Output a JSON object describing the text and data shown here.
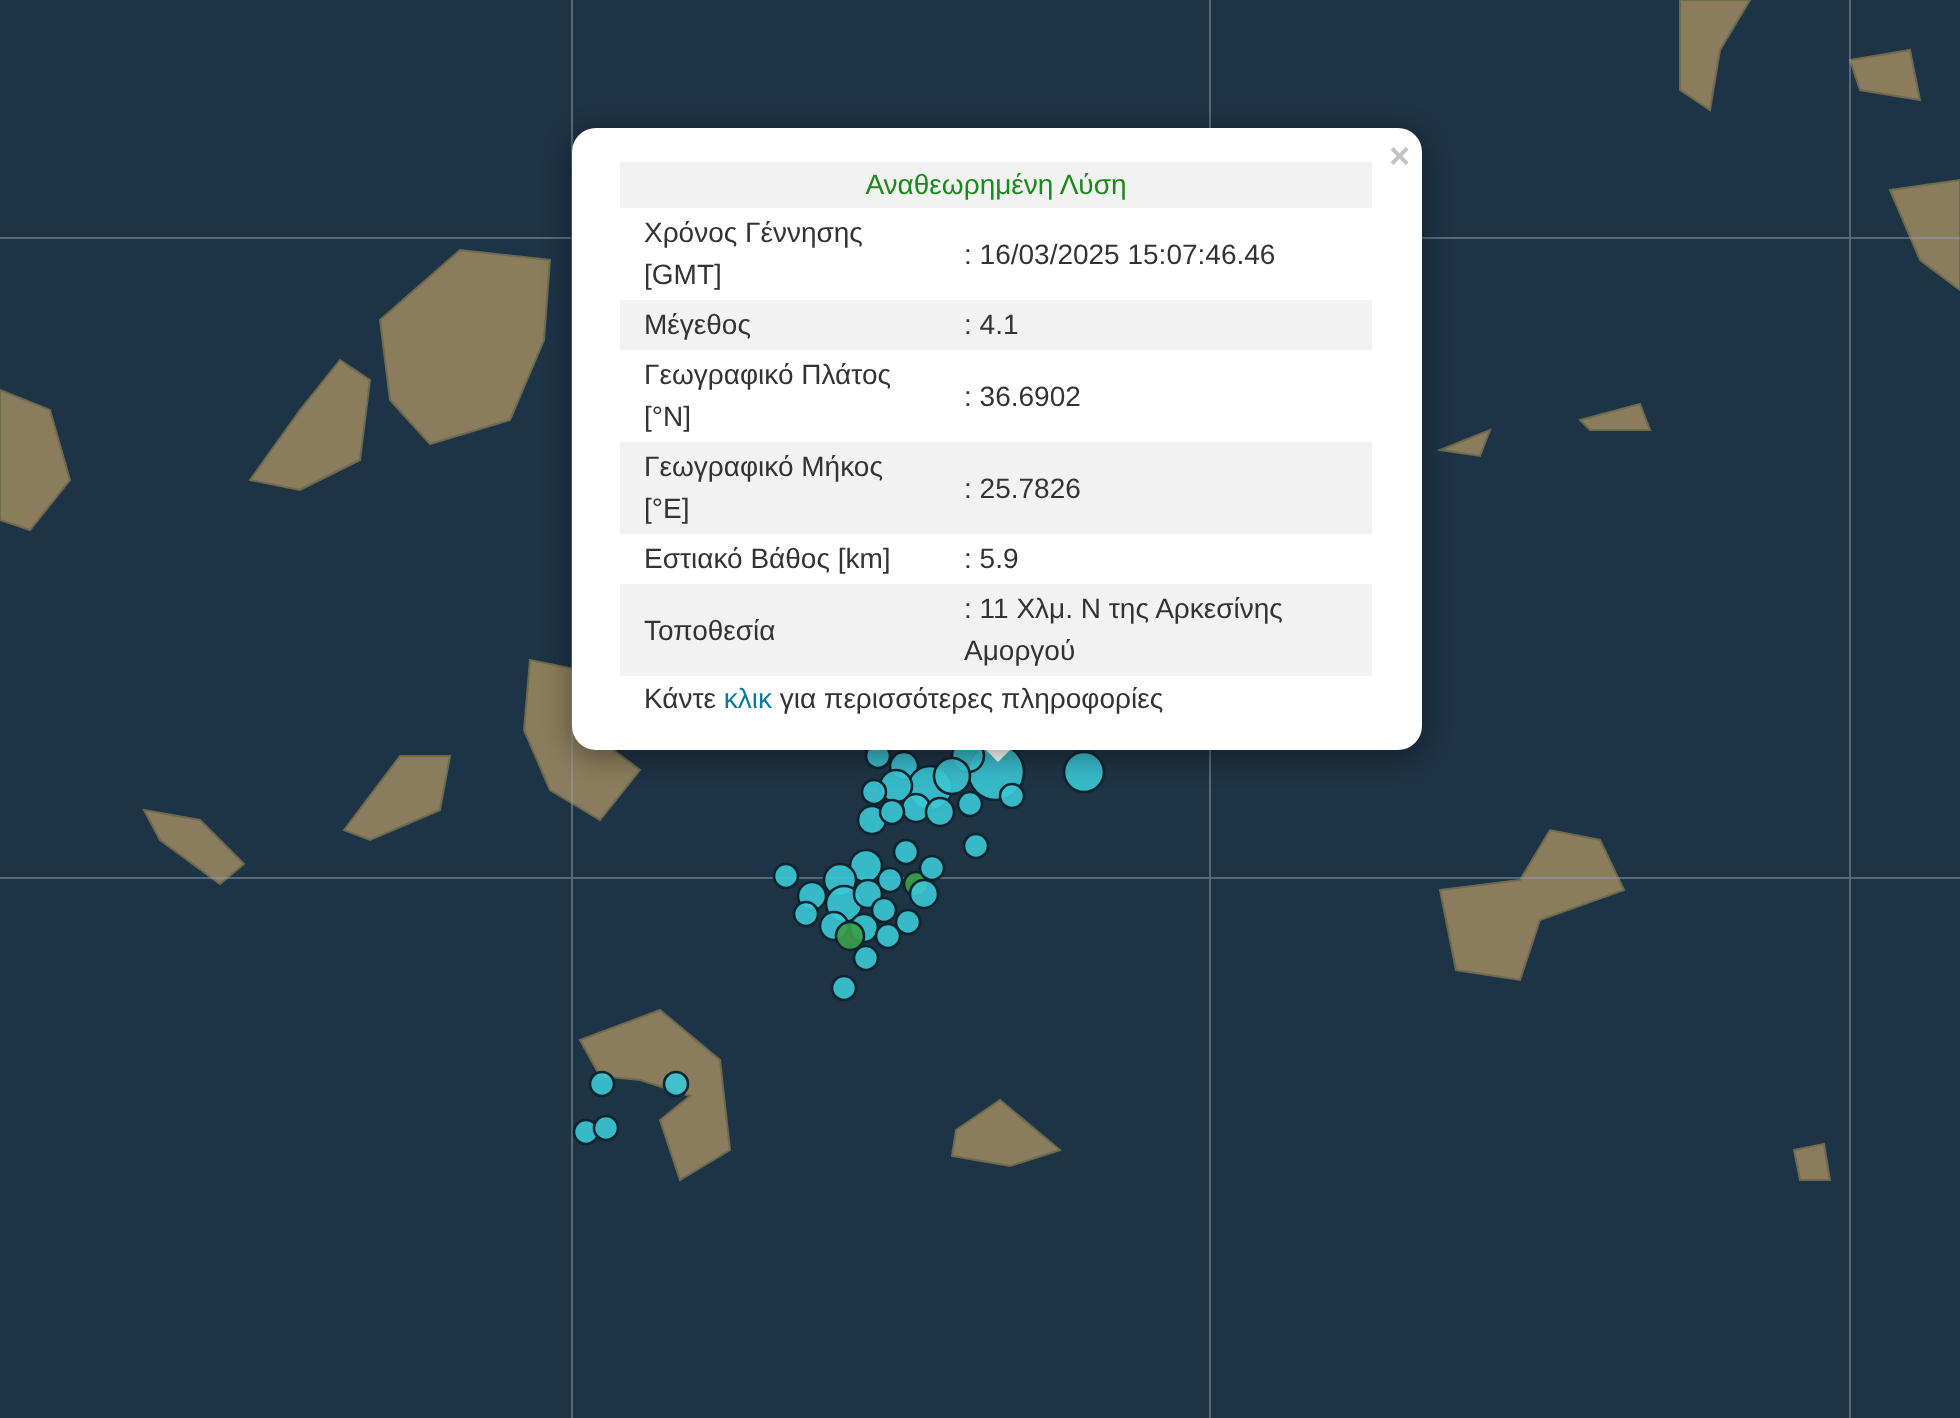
{
  "popup": {
    "close": "×",
    "title": "Αναθεωρημένη Λύση",
    "rows": [
      {
        "label": "Χρόνος Γέννησης [GMT]",
        "value": ": 16/03/2025 15:07:46.46"
      },
      {
        "label": "Μέγεθος",
        "value": ": 4.1"
      },
      {
        "label": "Γεωγραφικό Πλάτος [°N]",
        "value": ": 36.6902"
      },
      {
        "label": "Γεωγραφικό Μήκος [°E]",
        "value": ": 25.7826"
      },
      {
        "label": "Εστιακό Βάθος [km]",
        "value": ": 5.9"
      },
      {
        "label": "Τοποθεσία",
        "value": ": 11 Χλμ. Ν της Αρκεσίνης Αμοργού"
      }
    ],
    "footer": {
      "before": "Κάντε ",
      "link": "κλικ",
      "after": " για περισσότερες πληροφορίες"
    }
  }
}
